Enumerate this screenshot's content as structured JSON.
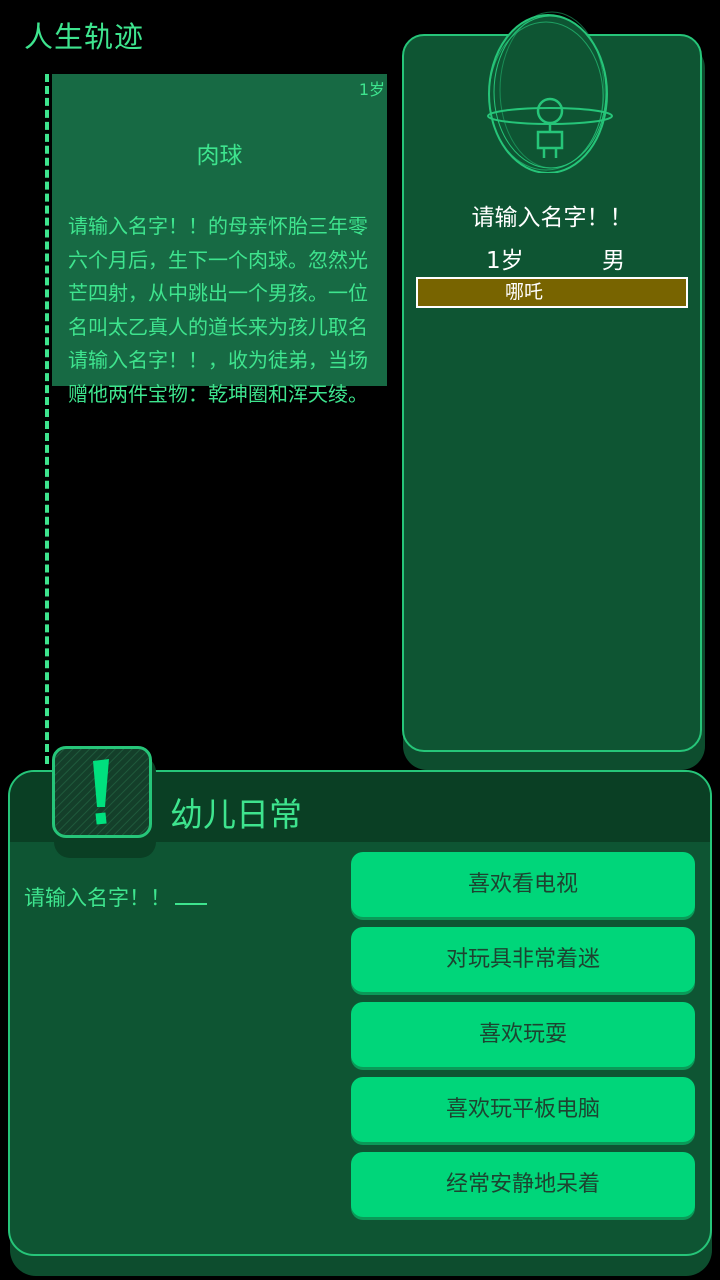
{
  "header": {
    "title": "人生轨迹"
  },
  "event": {
    "age": "1岁",
    "title": "肉球",
    "body": "请输入名字！！的母亲怀胎三年零六个月后，生下一个肉球。忽然光芒四射，从中跳出一个男孩。一位名叫太乙真人的道长来为孩儿取名请输入名字！！，收为徒弟，当场赠他两件宝物：乾坤圈和浑天绫。"
  },
  "profile": {
    "name": "请输入名字！！",
    "age": "1岁",
    "gender": "男",
    "role": "哪吒",
    "avatar_icon": "egg-avatar-icon"
  },
  "stage": {
    "title": "幼儿日常",
    "badge_icon": "exclamation-icon",
    "prompt": "请输入名字！！",
    "choices": [
      "喜欢看电视",
      "对玩具非常着迷",
      "喜欢玩耍",
      "喜欢玩平板电脑",
      "经常安静地呆着"
    ]
  },
  "colors": {
    "accent": "#3ee48e",
    "panel": "#0e5533",
    "button": "#00d67a",
    "role_bar": "#786400"
  }
}
